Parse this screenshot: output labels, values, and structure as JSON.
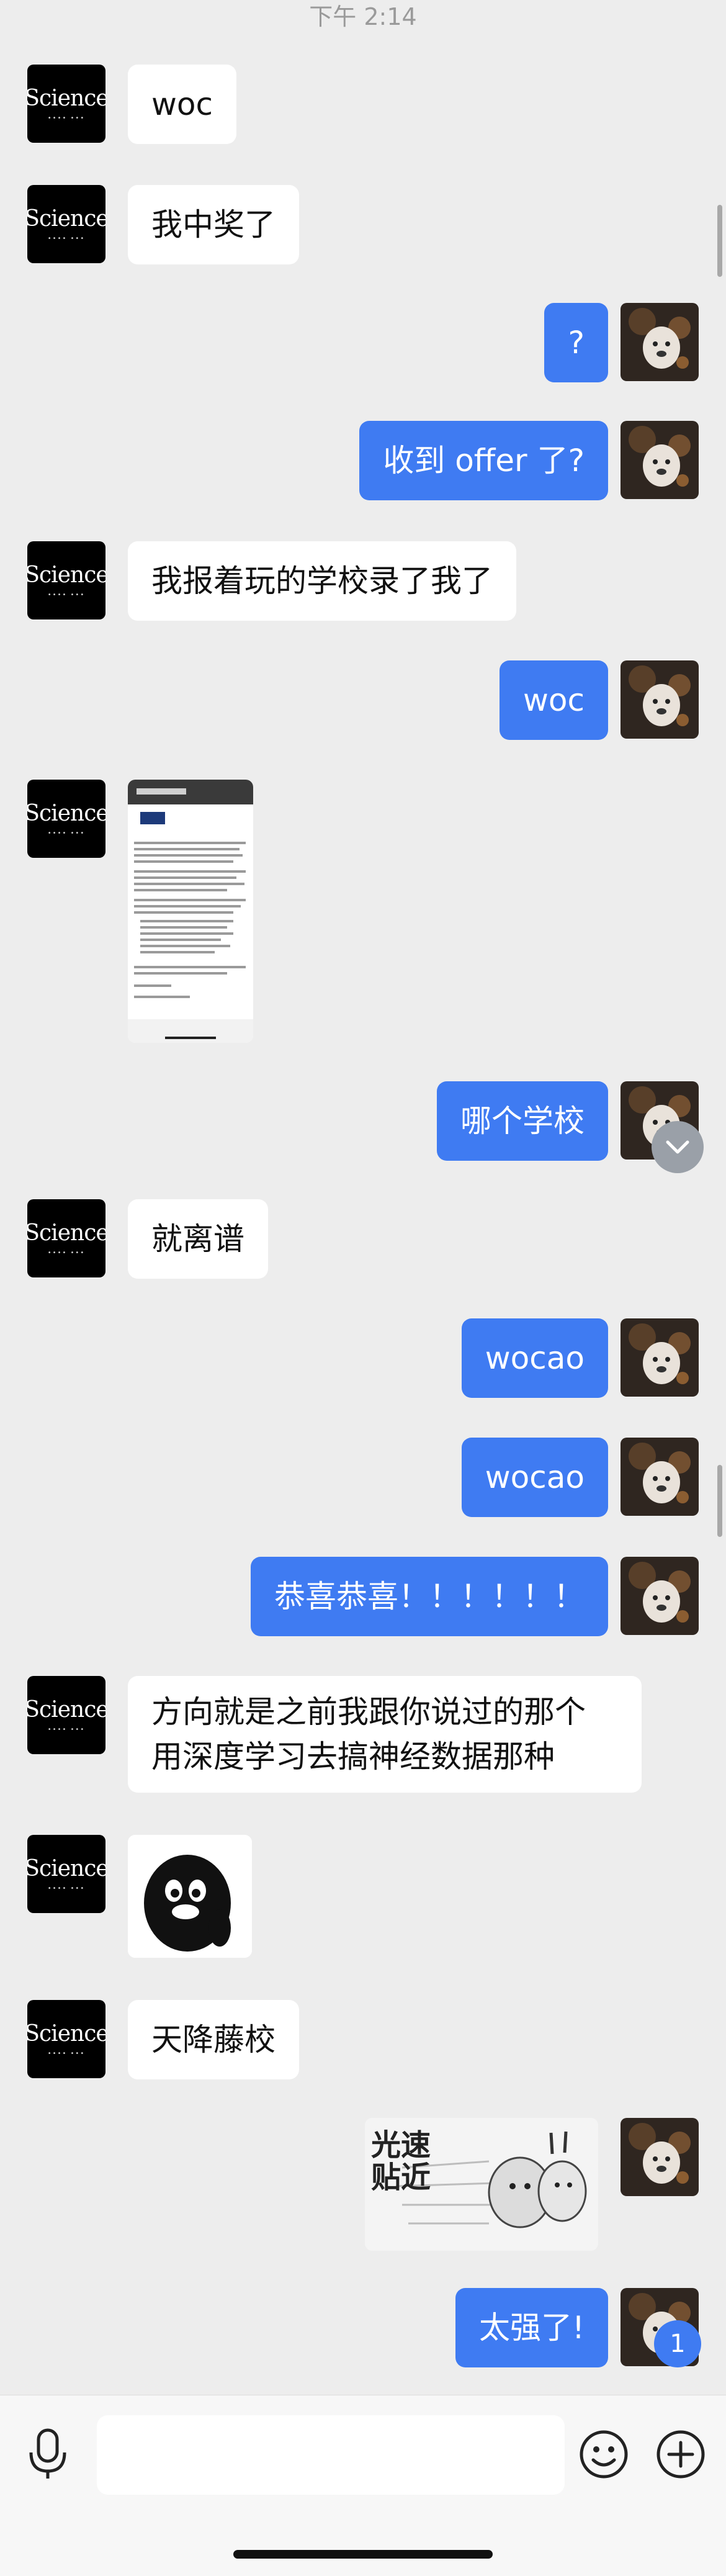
{
  "chat": {
    "timestamp": "下午 2:14",
    "contact_avatar_label": "Science",
    "messages": [
      {
        "side": "in",
        "text": "woc"
      },
      {
        "side": "in",
        "text": "我中奖了"
      },
      {
        "side": "out",
        "text": "?"
      },
      {
        "side": "out",
        "text": "收到 offer 了?"
      },
      {
        "side": "in",
        "text": "我报着玩的学校录了我了"
      },
      {
        "side": "out",
        "text": "woc"
      },
      {
        "side": "in",
        "type": "image",
        "description": "document screenshot"
      },
      {
        "side": "out",
        "text": "哪个学校"
      },
      {
        "side": "in",
        "text": "就离谱"
      },
      {
        "side": "out",
        "text": "wocao"
      },
      {
        "side": "out",
        "text": "wocao"
      },
      {
        "side": "out",
        "text": "恭喜恭喜！！！！！！"
      },
      {
        "side": "in",
        "lines": [
          "方向就是之前我跟你说过的那个",
          "用深度学习去搞神经数据那种"
        ]
      },
      {
        "side": "in",
        "type": "sticker",
        "icon": "penguin-sticker"
      },
      {
        "side": "in",
        "text": "天降藤校"
      },
      {
        "side": "out",
        "type": "sticker",
        "sticker_text": [
          "光速",
          "贴近"
        ]
      },
      {
        "side": "out",
        "text": "太强了!"
      }
    ],
    "unread_count": "1"
  },
  "input_bar": {
    "voice_icon": "microphone-icon",
    "emoji_icon": "smiley-icon",
    "more_icon": "plus-circle-icon"
  },
  "colors": {
    "outgoing_bubble": "#3f7bf2",
    "incoming_bubble": "#ffffff",
    "background": "#ededed"
  }
}
